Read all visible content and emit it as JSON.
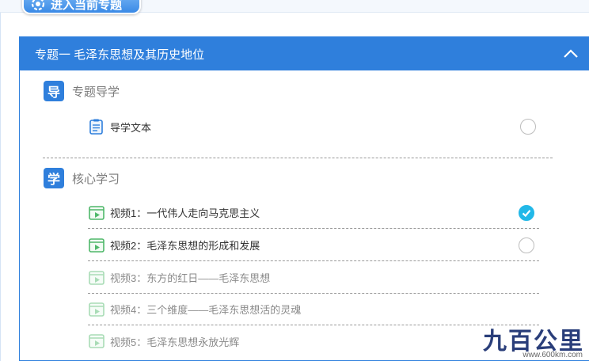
{
  "entry_tab": {
    "label": "进入当前专题"
  },
  "topic": {
    "title": "专题一 毛泽东思想及其历史地位"
  },
  "sections": [
    {
      "badge": "导",
      "title": "专题导学",
      "items": [
        {
          "label": "导学文本",
          "status": "pending",
          "icon": "document-icon"
        }
      ]
    },
    {
      "badge": "学",
      "title": "核心学习",
      "items": [
        {
          "label": "视频1：一代伟人走向马克思主义",
          "status": "done",
          "icon": "video-icon"
        },
        {
          "label": "视频2：毛泽东思想的形成和发展",
          "status": "pending",
          "icon": "video-icon"
        },
        {
          "label": "视频3：东方的红日——毛泽东思想",
          "status": "locked",
          "icon": "video-icon"
        },
        {
          "label": "视频4：三个维度——毛泽东思想活的灵魂",
          "status": "locked",
          "icon": "video-icon"
        },
        {
          "label": "视频5：毛泽东思想永放光辉",
          "status": "locked",
          "icon": "video-icon"
        }
      ]
    }
  ],
  "watermark": {
    "logo": "九百公里",
    "url": "www.600km.com"
  },
  "colors": {
    "primary": "#2f7fdc",
    "check": "#22b8e8",
    "video_active": "#4fb86a",
    "video_faded": "#a9dcb6"
  }
}
